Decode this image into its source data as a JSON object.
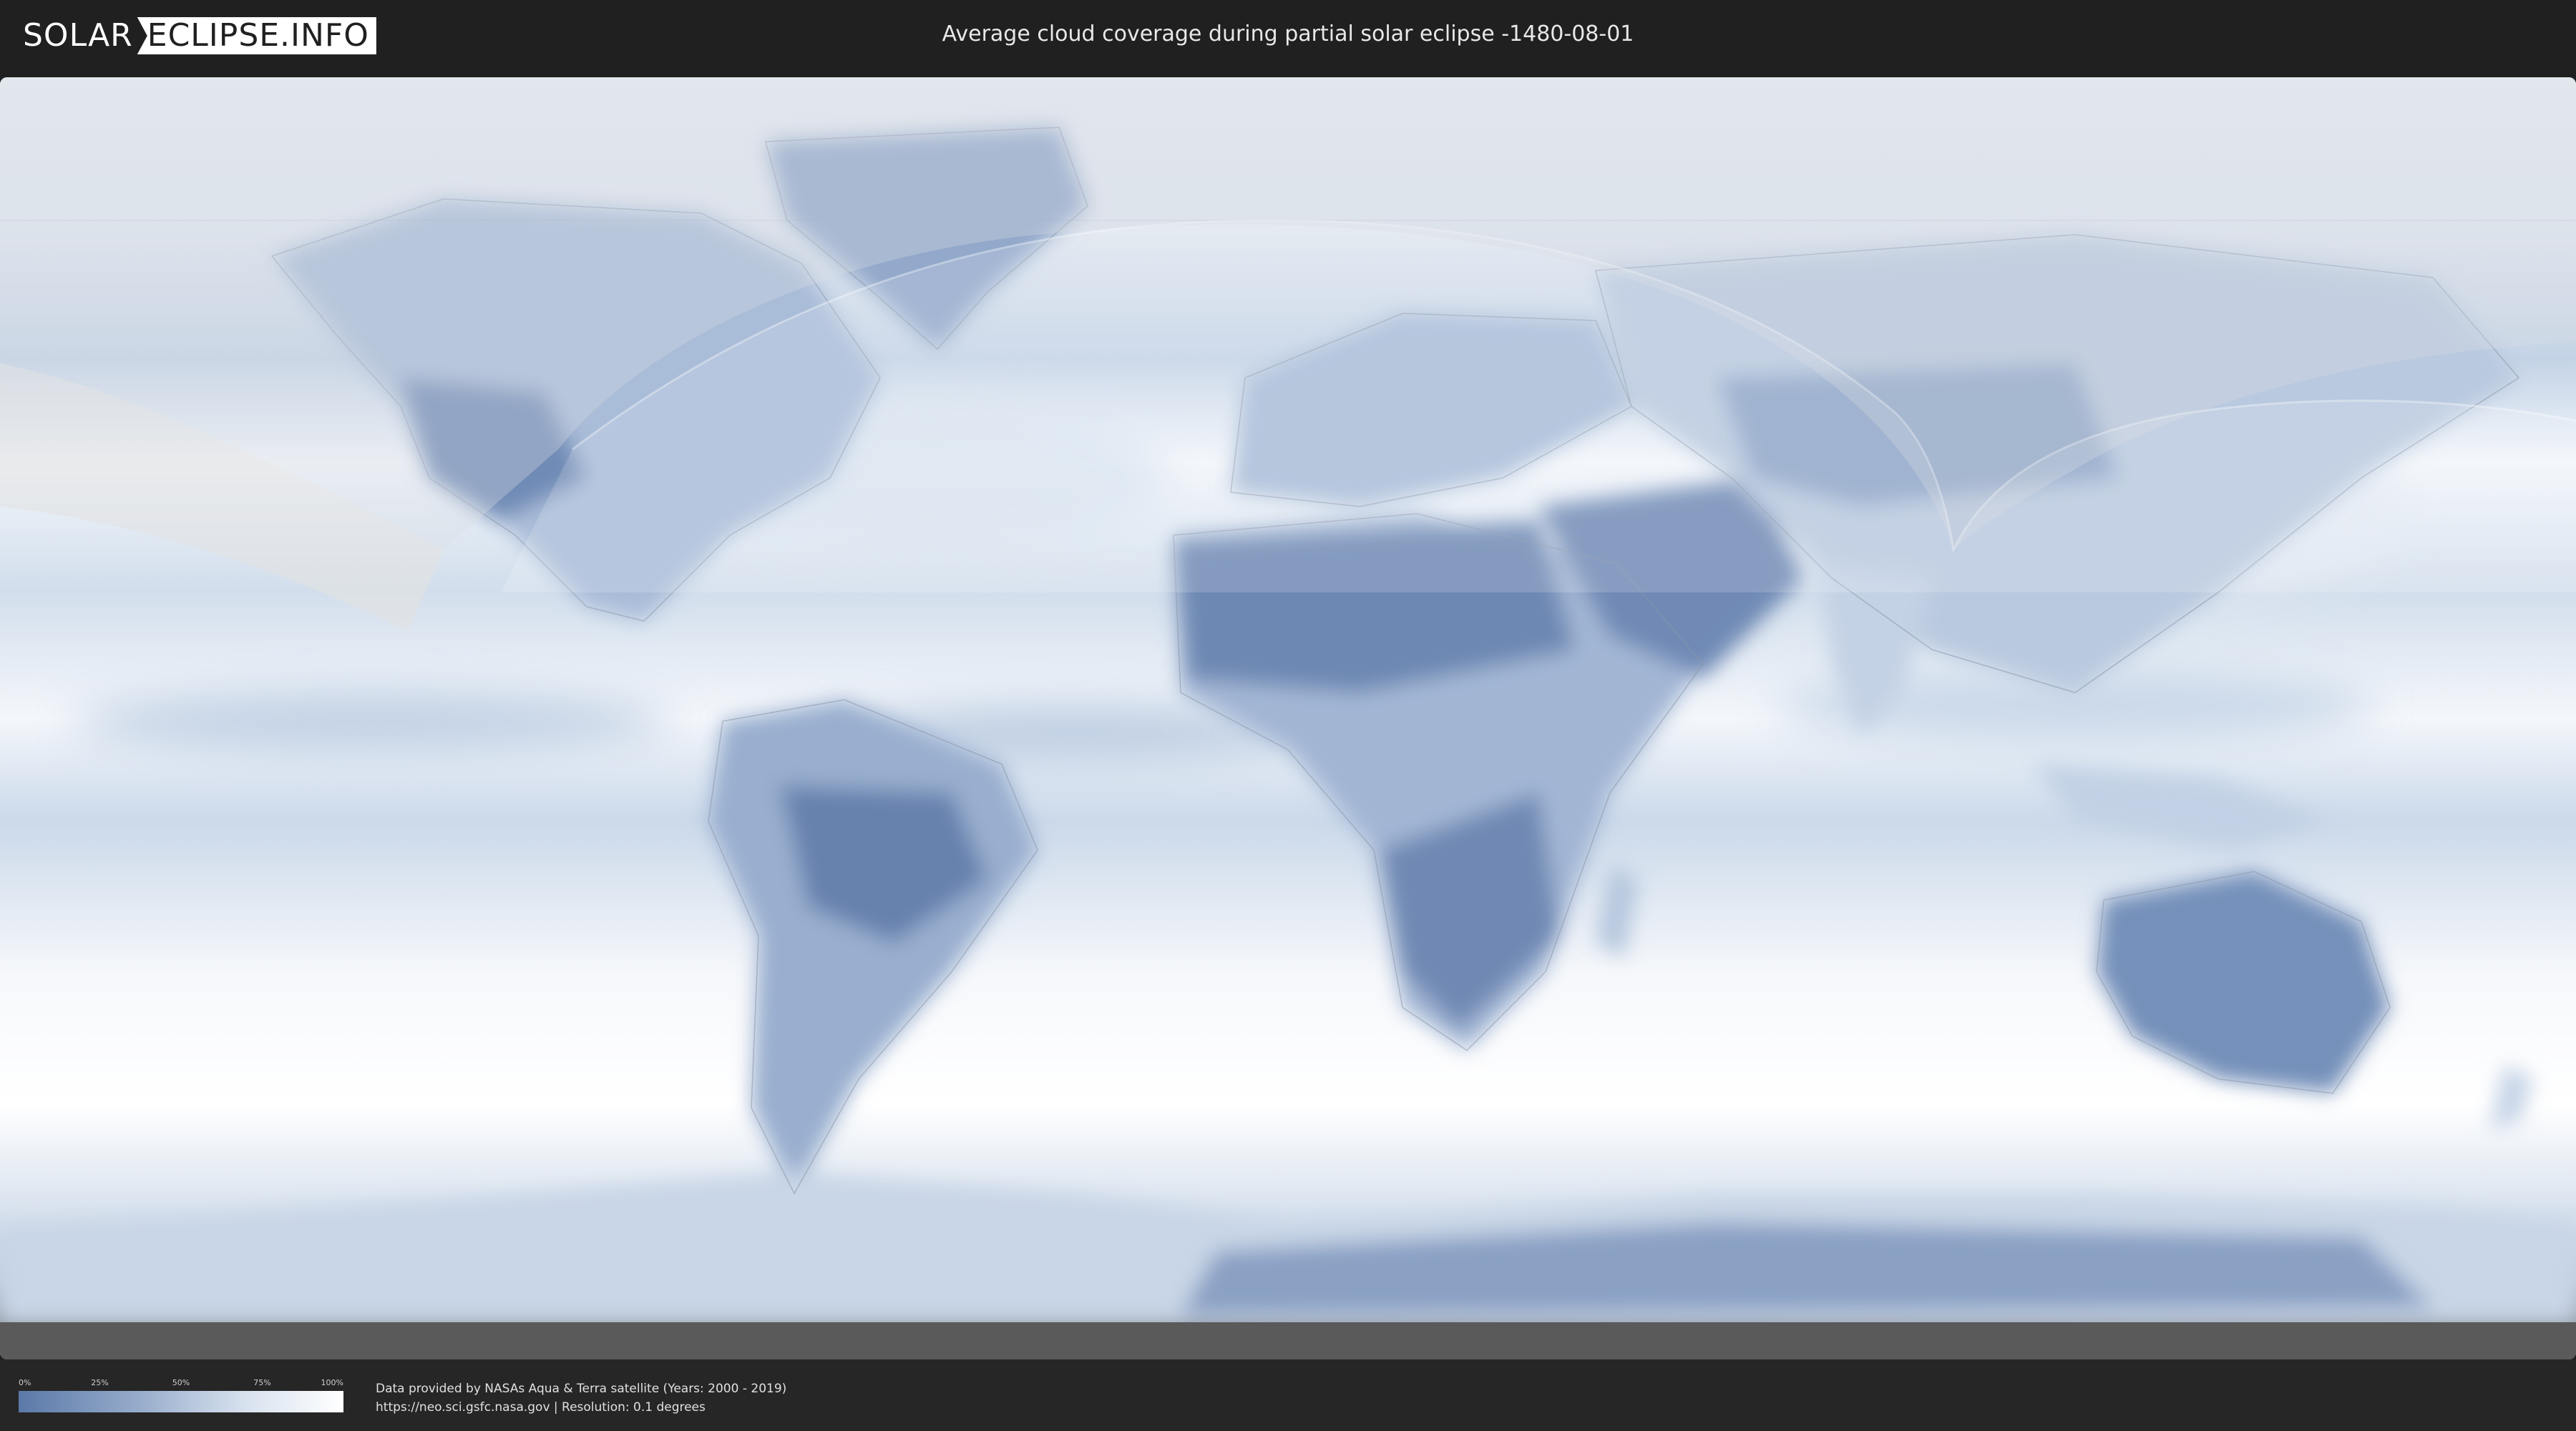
{
  "header": {
    "logo": {
      "part1": "SOLAR",
      "part2": "ECLIPSE.INFO"
    },
    "title": "Average cloud coverage during partial solar eclipse -1480-08-01"
  },
  "map": {
    "colors": {
      "ocean": "#eef2f8",
      "cloud_dense": "#ffffff",
      "cloud_sparse": "#5b79a8",
      "land_dry": "#6a85b1",
      "eclipse_zone": "#ffffff",
      "night_zone": "#d9dde2",
      "border": "#8a96a8"
    }
  },
  "legend": {
    "ticks": [
      "0%",
      "25%",
      "50%",
      "75%",
      "100%"
    ],
    "colors": [
      "#5b79a8",
      "#93a9c9",
      "#d8e2ef",
      "#ffffff"
    ]
  },
  "credits": {
    "line1": "Data provided by NASAs Aqua & Terra satellite (Years: 2000 - 2019)",
    "line2": "https://neo.sci.gsfc.nasa.gov | Resolution: 0.1 degrees"
  }
}
